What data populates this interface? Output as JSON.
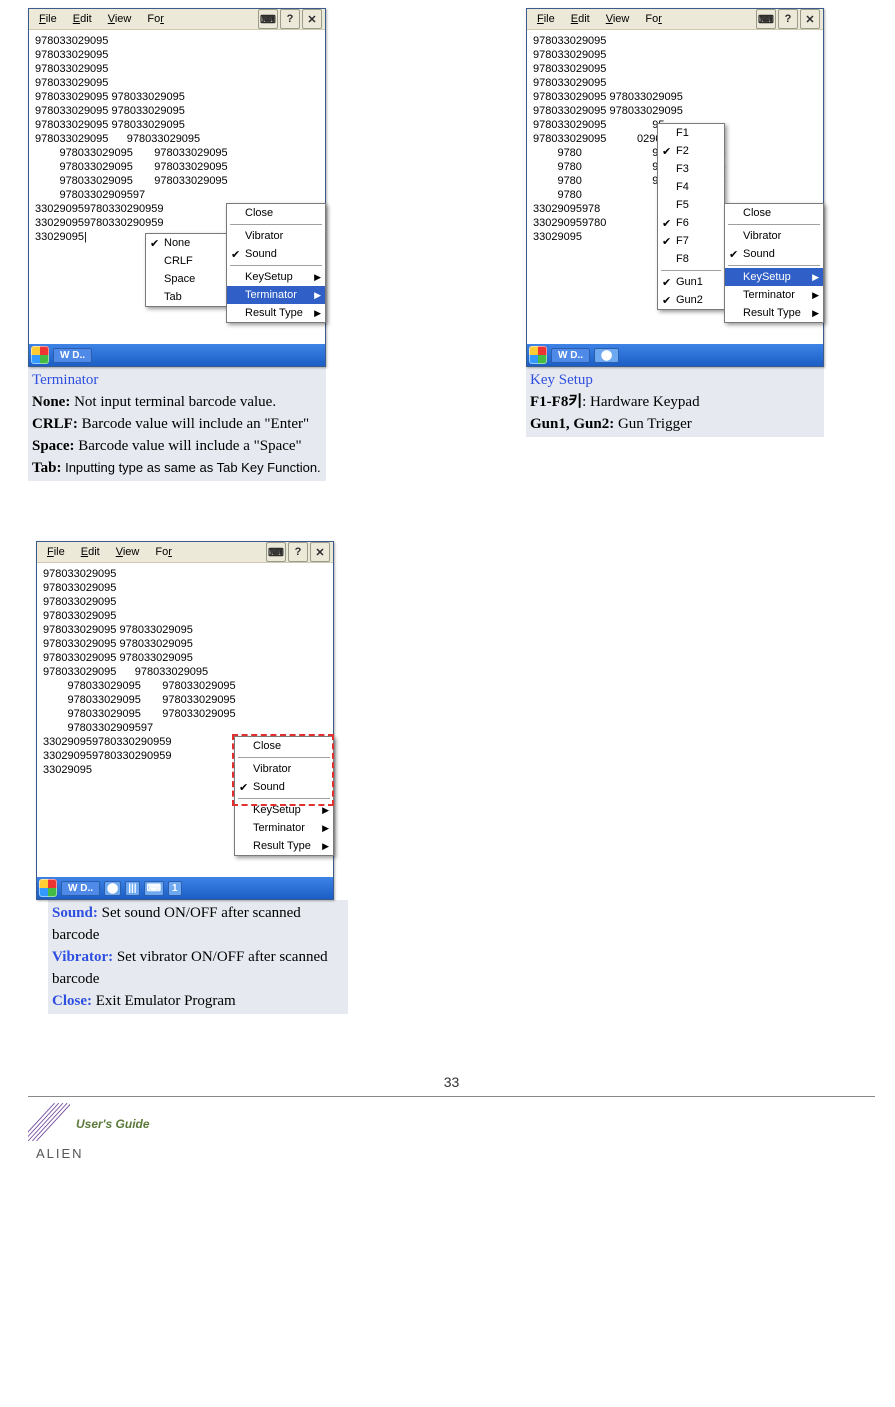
{
  "menus": {
    "file": "File",
    "edit": "Edit",
    "view": "View",
    "for": "For"
  },
  "taskbar_item": "W D..",
  "text_lines_a": [
    "978033029095",
    "978033029095",
    "978033029095",
    "978033029095",
    "978033029095 978033029095",
    "978033029095 978033029095",
    "978033029095 978033029095",
    "978033029095      978033029095",
    "        978033029095       978033029095",
    "        978033029095       978033029095",
    "        978033029095       978033029095",
    "        97803302909597",
    "330290959780330290959",
    "330290959780330290959",
    "33029095|"
  ],
  "text_lines_b": [
    "978033029095",
    "978033029095",
    "978033029095",
    "978033029095",
    "978033029095 978033029095",
    "978033029095 978033029095",
    "978033029095               95",
    "978033029095          029095",
    "        9780                       978033029095",
    "        9780                       978033029095",
    "        9780                       978033029095",
    "        9780",
    "33029095978",
    "330290959780",
    "33029095"
  ],
  "text_lines_c": [
    "978033029095",
    "978033029095",
    "978033029095",
    "978033029095",
    "978033029095 978033029095",
    "978033029095 978033029095",
    "978033029095 978033029095",
    "978033029095      978033029095",
    "        978033029095       978033029095",
    "        978033029095       978033029095",
    "        978033029095       978033029095",
    "        97803302909597",
    "330290959780330290959",
    "330290959780330290959",
    "33029095"
  ],
  "popup_terminator_left": [
    {
      "label": "None",
      "checked": true
    },
    {
      "label": "CRLF"
    },
    {
      "label": "Space"
    },
    {
      "label": "Tab"
    }
  ],
  "popup_right_common": [
    {
      "label": "Close"
    },
    {
      "sep": true
    },
    {
      "label": "Vibrator"
    },
    {
      "label": "Sound",
      "checked": true
    },
    {
      "sep": true
    },
    {
      "label": "KeySetup",
      "arrow": true
    },
    {
      "label": "Terminator",
      "arrow": true
    },
    {
      "label": "Result Type",
      "arrow": true
    }
  ],
  "popup_right_sel_terminator": "Terminator",
  "popup_right_sel_keysetup": "KeySetup",
  "popup_keysetup_left": [
    {
      "label": "F1"
    },
    {
      "label": "F2",
      "checked": true
    },
    {
      "label": "F3"
    },
    {
      "label": "F4"
    },
    {
      "label": "F5"
    },
    {
      "label": "F6",
      "checked": true
    },
    {
      "label": "F7",
      "checked": true
    },
    {
      "label": "F8"
    },
    {
      "sep": true
    },
    {
      "label": "Gun1",
      "checked": true
    },
    {
      "label": "Gun2",
      "checked": true
    }
  ],
  "captions": {
    "a_title": "Terminator",
    "a_lines": [
      [
        "None:",
        " Not input terminal barcode value."
      ],
      [
        "CRLF:",
        " Barcode value will include an \"Enter\""
      ],
      [
        "Space:",
        " Barcode value will include a \"Space\""
      ],
      [
        "Tab:",
        " Inputting type as same as Tab Key Function."
      ]
    ],
    "b_title": "Key Setup",
    "b_lines": [
      [
        "F1-F8키",
        ": Hardware Keypad"
      ],
      [
        "Gun1, Gun2:",
        " Gun Trigger"
      ]
    ],
    "c_lines": [
      [
        "Sound:",
        " Set sound ON/OFF after scanned barcode"
      ],
      [
        "Vibrator:",
        " Set vibrator ON/OFF after scanned barcode"
      ],
      [
        "Close:",
        " Exit Emulator Program"
      ]
    ]
  },
  "page_number": "33",
  "users_guide": "User's Guide",
  "alien": "ALIEN"
}
